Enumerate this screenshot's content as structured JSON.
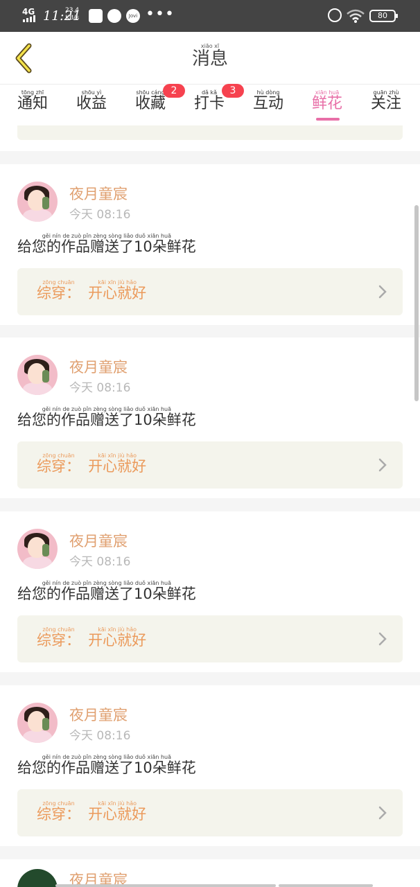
{
  "status_bar": {
    "network": "4G",
    "time": "11:21",
    "speed": "23.4",
    "speed_unit": "KB/s",
    "app3_label": "Jovi",
    "battery": "80"
  },
  "header": {
    "title": {
      "hz": "消息",
      "py": "xiāo xī"
    }
  },
  "tabs": [
    {
      "hz": "通知",
      "py": "tōng zhī"
    },
    {
      "hz": "收益",
      "py": "shōu yì"
    },
    {
      "hz": "收藏",
      "py": "shōu cáng",
      "badge": "2"
    },
    {
      "hz": "打卡",
      "py": "dǎ kǎ",
      "badge": "3"
    },
    {
      "hz": "互动",
      "py": "hù dòng"
    },
    {
      "hz": "鲜花",
      "py": "xiān huā",
      "active": true
    },
    {
      "hz": "关注",
      "py": "guān zhù"
    }
  ],
  "colors": {
    "accent": "#e86fa7",
    "badge": "#f6424f",
    "name": "#e0a070",
    "work": "#eb9a5b",
    "quote_bg": "#f4f4ec"
  },
  "cards": [
    {
      "name": {
        "hz": "夜月童宸"
      },
      "time": "今天 08:16",
      "message": {
        "hz": "给您的作品赠送了10朵鲜花",
        "py": "gěi nín de zuò pǐn zèng sòng liǎo duǒ xiān huā"
      },
      "work": {
        "label_hz": "综穿：",
        "label_py": "zōng chuān",
        "title_hz": "开心就好",
        "title_py": "kāi xīn jiù hǎo"
      }
    },
    {
      "name": {
        "hz": "夜月童宸"
      },
      "time": "今天 08:16",
      "message": {
        "hz": "给您的作品赠送了10朵鲜花",
        "py": "gěi nín de zuò pǐn zèng sòng liǎo duǒ xiān huā"
      },
      "work": {
        "label_hz": "综穿：",
        "label_py": "zōng chuān",
        "title_hz": "开心就好",
        "title_py": "kāi xīn jiù hǎo"
      }
    },
    {
      "name": {
        "hz": "夜月童宸"
      },
      "time": "今天 08:16",
      "message": {
        "hz": "给您的作品赠送了10朵鲜花",
        "py": "gěi nín de zuò pǐn zèng sòng liǎo duǒ xiān huā"
      },
      "work": {
        "label_hz": "综穿：",
        "label_py": "zōng chuān",
        "title_hz": "开心就好",
        "title_py": "kāi xīn jiù hǎo"
      }
    },
    {
      "name": {
        "hz": "夜月童宸"
      },
      "time": "今天 08:16",
      "message": {
        "hz": "给您的作品赠送了10朵鲜花",
        "py": "gěi nín de zuò pǐn zèng sòng liǎo duǒ xiān huā"
      },
      "work": {
        "label_hz": "综穿：",
        "label_py": "zōng chuān",
        "title_hz": "开心就好",
        "title_py": "kāi xīn jiù hǎo"
      }
    }
  ],
  "partial_card": {
    "name": "夜月童宸"
  },
  "icons": {
    "back": "chevron-left-icon",
    "arrow": "chevron-right-icon",
    "alarm": "alarm-icon",
    "wifi": "wifi-icon",
    "battery": "battery-icon"
  }
}
